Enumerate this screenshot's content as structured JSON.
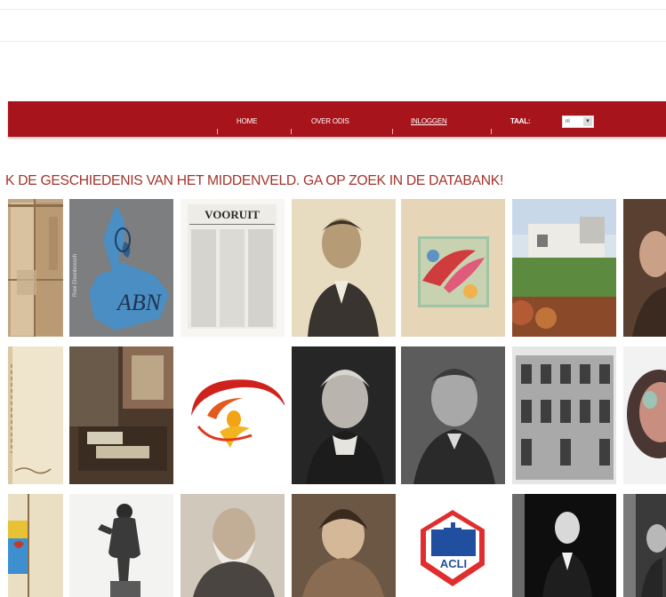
{
  "nav": {
    "home": "HOME",
    "about": "OVER ODIS",
    "login": "INLOGGEN",
    "language_label": "TAAL:",
    "language_value": "nl"
  },
  "tagline": "K DE GESCHIEDENIS VAN HET MIDDENVELD. GA OP ZOEK IN DE DATABANK!",
  "gallery": {
    "newspaper_masthead": "VOORUIT",
    "logo_text": "ACLI",
    "banner_text": "ABN"
  },
  "colors": {
    "accent": "#a8141c",
    "tagline": "#a5332b"
  }
}
